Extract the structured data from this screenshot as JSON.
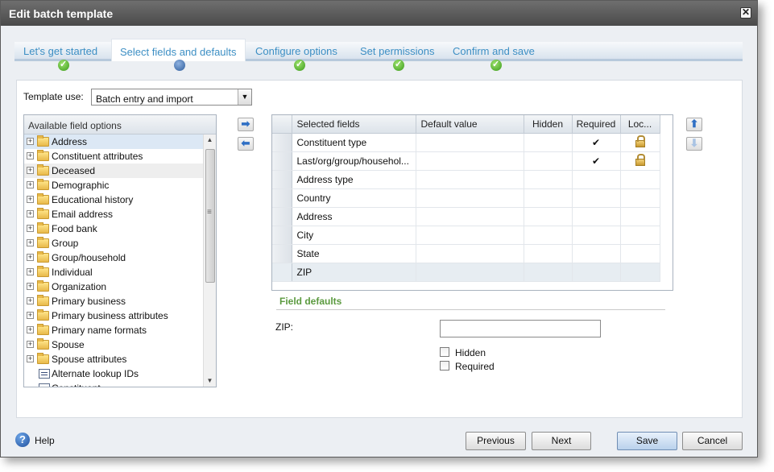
{
  "dialog": {
    "title": "Edit batch template",
    "close_glyph": "✕"
  },
  "wizard": {
    "steps": [
      {
        "label": "Let's get started",
        "status": "done"
      },
      {
        "label": "Select fields and defaults",
        "status": "current"
      },
      {
        "label": "Configure options",
        "status": "done"
      },
      {
        "label": "Set permissions",
        "status": "done"
      },
      {
        "label": "Confirm and save",
        "status": "done"
      }
    ]
  },
  "template_use": {
    "label": "Template use:",
    "value": "Batch entry and import"
  },
  "available": {
    "header": "Available field options",
    "items": [
      {
        "label": "Address",
        "type": "folder"
      },
      {
        "label": "Constituent attributes",
        "type": "folder"
      },
      {
        "label": "Deceased",
        "type": "folder"
      },
      {
        "label": "Demographic",
        "type": "folder"
      },
      {
        "label": "Educational history",
        "type": "folder"
      },
      {
        "label": "Email address",
        "type": "folder"
      },
      {
        "label": "Food bank",
        "type": "folder"
      },
      {
        "label": "Group",
        "type": "folder"
      },
      {
        "label": "Group/household",
        "type": "folder"
      },
      {
        "label": "Individual",
        "type": "folder"
      },
      {
        "label": "Organization",
        "type": "folder"
      },
      {
        "label": "Primary business",
        "type": "folder"
      },
      {
        "label": "Primary business attributes",
        "type": "folder"
      },
      {
        "label": "Primary name formats",
        "type": "folder"
      },
      {
        "label": "Spouse",
        "type": "folder"
      },
      {
        "label": "Spouse attributes",
        "type": "folder"
      },
      {
        "label": "Alternate lookup IDs",
        "type": "field"
      },
      {
        "label": "Constituent...",
        "type": "field"
      }
    ]
  },
  "selected": {
    "columns": {
      "field": "Selected fields",
      "default": "Default value",
      "hidden": "Hidden",
      "required": "Required",
      "locked": "Loc..."
    },
    "rows": [
      {
        "field": "Constituent type",
        "default": "",
        "hidden": "",
        "required": "✔",
        "locked": true
      },
      {
        "field": "Last/org/group/househol...",
        "default": "",
        "hidden": "",
        "required": "✔",
        "locked": true
      },
      {
        "field": "Address type",
        "default": "",
        "hidden": "",
        "required": "",
        "locked": false
      },
      {
        "field": "Country",
        "default": "",
        "hidden": "",
        "required": "",
        "locked": false
      },
      {
        "field": "Address",
        "default": "",
        "hidden": "",
        "required": "",
        "locked": false
      },
      {
        "field": "City",
        "default": "",
        "hidden": "",
        "required": "",
        "locked": false
      },
      {
        "field": "State",
        "default": "",
        "hidden": "",
        "required": "",
        "locked": false
      },
      {
        "field": "ZIP",
        "default": "",
        "hidden": "",
        "required": "",
        "locked": false
      }
    ]
  },
  "move": {
    "add": "➡",
    "remove": "⬅",
    "up": "⬆",
    "down": "⬇"
  },
  "field_defaults": {
    "title": "Field defaults",
    "field_label": "ZIP:",
    "value": "",
    "hidden_label": "Hidden",
    "required_label": "Required"
  },
  "footer": {
    "help_glyph": "?",
    "help": "Help",
    "previous": "Previous",
    "next": "Next",
    "save": "Save",
    "cancel": "Cancel"
  },
  "colors": {
    "accent": "#3d8fc4",
    "section_title": "#5b9a3f",
    "titlebar": "#4a4a4a"
  }
}
